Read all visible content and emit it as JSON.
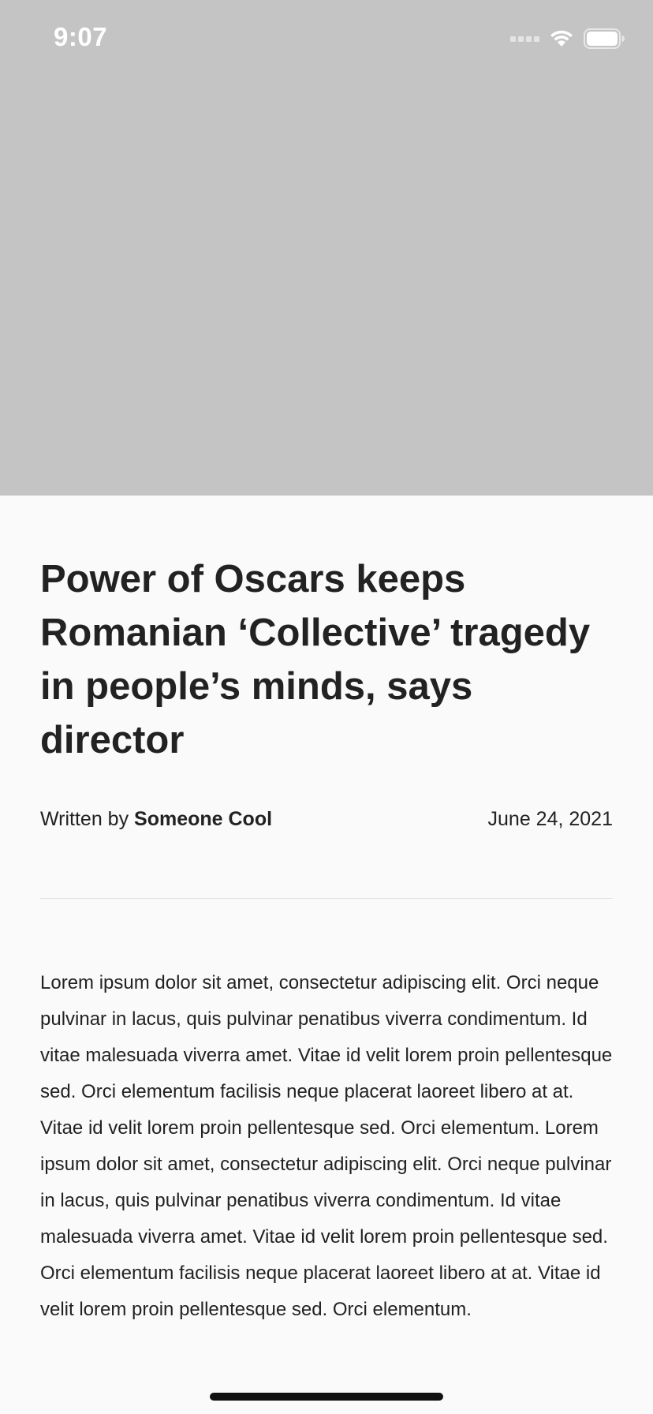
{
  "status_bar": {
    "time": "9:07",
    "icons": [
      "cellular-signal-icon",
      "wifi-icon",
      "battery-icon"
    ]
  },
  "hero": {
    "placeholder_color": "#c4c4c4"
  },
  "article": {
    "title": "Power of Oscars keeps Romanian ‘Collective’ tragedy in people’s minds, says director",
    "byline_prefix": "Written by ",
    "author": "Someone Cool",
    "date": "June 24, 2021",
    "body": "Lorem ipsum dolor sit amet, consectetur adipiscing elit. Orci neque pulvinar in lacus, quis pulvinar penatibus viverra condimentum. Id vitae malesuada viverra amet. Vitae id velit lorem proin pellentesque sed. Orci elementum facilisis neque placerat laoreet libero at at. Vitae id velit lorem proin pellentesque sed. Orci elementum. Lorem ipsum dolor sit amet, consectetur adipiscing elit. Orci neque pulvinar in lacus, quis pulvinar penatibus viverra condimentum. Id vitae malesuada viverra amet. Vitae id velit lorem proin pellentesque sed. Orci elementum facilisis neque placerat laoreet libero at at. Vitae id velit lorem proin pellentesque sed. Orci elementum."
  },
  "colors": {
    "background": "#fafafa",
    "text": "#222222",
    "divider": "#e0e0e0"
  }
}
